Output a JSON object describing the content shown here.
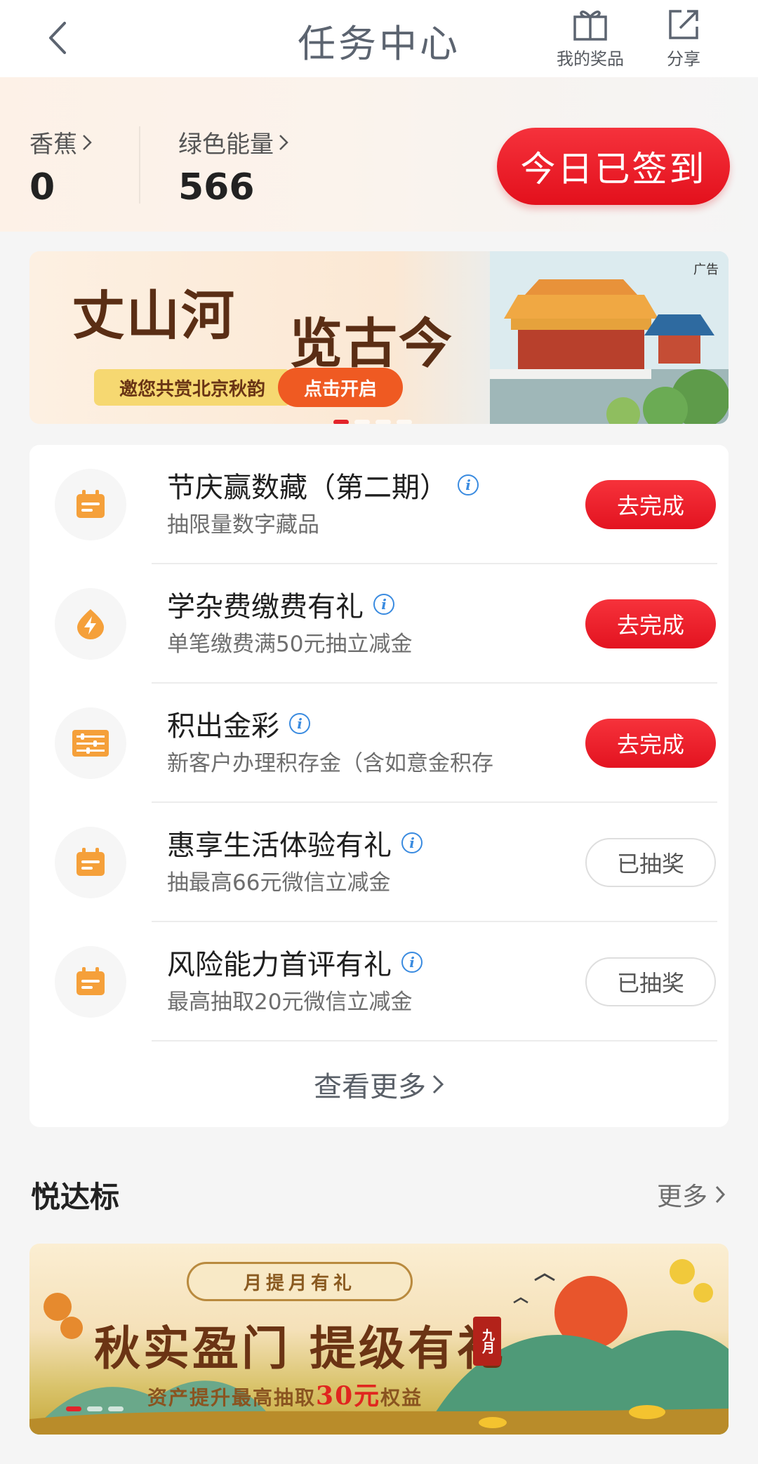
{
  "header": {
    "title": "任务中心",
    "actions": [
      {
        "label": "我的奖品",
        "icon": "gift-icon"
      },
      {
        "label": "分享",
        "icon": "share-icon"
      }
    ]
  },
  "points": {
    "banana_label": "香蕉",
    "banana_value": "0",
    "energy_label": "绿色能量",
    "energy_value": "566",
    "signin_label": "今日已签到"
  },
  "ad_banner": {
    "tag": "广告",
    "title_part1": "丈山河",
    "title_part2": "览古今",
    "subtitle": "邀您共赏北京秋韵",
    "cta": "点击开启",
    "active_dot": 0,
    "dot_count": 4
  },
  "tasks": [
    {
      "title": "节庆赢数藏（第二期）",
      "desc": "抽限量数字藏品",
      "icon": "calendar-icon",
      "button": "去完成",
      "status": "todo"
    },
    {
      "title": "学杂费缴费有礼",
      "desc": "单笔缴费满50元抽立减金",
      "icon": "lightning-icon",
      "button": "去完成",
      "status": "todo"
    },
    {
      "title": "积出金彩",
      "desc": "新客户办理积存金（含如意金积存",
      "icon": "abacus-icon",
      "button": "去完成",
      "status": "todo"
    },
    {
      "title": "惠享生活体验有礼",
      "desc": "抽最高66元微信立减金",
      "icon": "calendar-icon",
      "button": "已抽奖",
      "status": "done"
    },
    {
      "title": "风险能力首评有礼",
      "desc": "最高抽取20元微信立减金",
      "icon": "calendar-icon",
      "button": "已抽奖",
      "status": "done"
    }
  ],
  "more_tasks_label": "查看更多",
  "section": {
    "title": "悦达标",
    "more_label": "更多"
  },
  "promo_banner": {
    "tag": "月提月有礼",
    "title": "秋实盈门 提级有礼",
    "stamp": "九月",
    "subtitle_before": "资产提升最高抽取",
    "subtitle_highlight": "30元",
    "subtitle_after": "权益",
    "active_dot": 0,
    "dot_count": 3
  },
  "colors": {
    "primary_red": "#e3101c",
    "icon_orange": "#f5a03a",
    "info_blue": "#3a8be0"
  }
}
